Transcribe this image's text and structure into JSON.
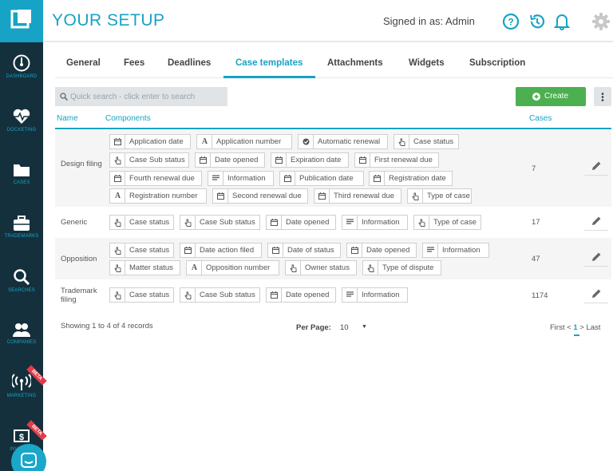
{
  "header": {
    "title": "YOUR SETUP",
    "signed_in": "Signed in as: Admin"
  },
  "sidebar": {
    "items": [
      {
        "label": "DASHBOARD",
        "icon": "gauge-icon"
      },
      {
        "label": "DOCKETING",
        "icon": "heartbeat-icon"
      },
      {
        "label": "CASES",
        "icon": "folder-icon"
      },
      {
        "label": "TRADEMARKS",
        "icon": "briefcase-icon"
      },
      {
        "label": "SEARCHES",
        "icon": "search-icon"
      },
      {
        "label": "COMPANIES",
        "icon": "people-icon"
      },
      {
        "label": "MARKETING",
        "icon": "broadcast-icon",
        "badge": "BETA"
      },
      {
        "label": "INVOICES",
        "icon": "dollar-icon",
        "badge": "BETA"
      }
    ]
  },
  "tabs": [
    "General",
    "Fees",
    "Deadlines",
    "Case templates",
    "Attachments",
    "Widgets",
    "Subscription"
  ],
  "active_tab": "Case templates",
  "search": {
    "placeholder": "Quick search - click enter to search"
  },
  "create_label": "Create",
  "columns": {
    "name": "Name",
    "components": "Components",
    "cases": "Cases"
  },
  "rows": [
    {
      "name": "Design filing",
      "cases": "7",
      "components": [
        {
          "icon": "calendar",
          "label": "Application date"
        },
        {
          "icon": "text",
          "label": "Application number"
        },
        {
          "icon": "check",
          "label": "Automatic renewal"
        },
        {
          "icon": "hand",
          "label": "Case status"
        },
        {
          "icon": "hand",
          "label": "Case Sub status"
        },
        {
          "icon": "calendar",
          "label": "Date opened"
        },
        {
          "icon": "calendar",
          "label": "Expiration date"
        },
        {
          "icon": "calendar",
          "label": "First renewal due"
        },
        {
          "icon": "calendar",
          "label": "Fourth renewal due"
        },
        {
          "icon": "lines",
          "label": "Information"
        },
        {
          "icon": "calendar",
          "label": "Publication date"
        },
        {
          "icon": "calendar",
          "label": "Registration date"
        },
        {
          "icon": "text",
          "label": "Registration number"
        },
        {
          "icon": "calendar",
          "label": "Second renewal due"
        },
        {
          "icon": "calendar",
          "label": "Third renewal due"
        },
        {
          "icon": "hand",
          "label": "Type of case"
        }
      ]
    },
    {
      "name": "Generic",
      "cases": "17",
      "components": [
        {
          "icon": "hand",
          "label": "Case status"
        },
        {
          "icon": "hand",
          "label": "Case Sub status"
        },
        {
          "icon": "calendar",
          "label": "Date opened"
        },
        {
          "icon": "lines",
          "label": "Information"
        },
        {
          "icon": "hand",
          "label": "Type of case"
        }
      ]
    },
    {
      "name": "Opposition",
      "cases": "47",
      "components": [
        {
          "icon": "hand",
          "label": "Case status"
        },
        {
          "icon": "calendar",
          "label": "Date action filed"
        },
        {
          "icon": "calendar",
          "label": "Date of status"
        },
        {
          "icon": "calendar",
          "label": "Date opened"
        },
        {
          "icon": "lines",
          "label": "Information"
        },
        {
          "icon": "hand",
          "label": "Matter status"
        },
        {
          "icon": "text",
          "label": "Opposition number"
        },
        {
          "icon": "hand",
          "label": "Owner status"
        },
        {
          "icon": "hand",
          "label": "Type of dispute"
        }
      ]
    },
    {
      "name": "Trademark filing",
      "cases": "1174",
      "components": [
        {
          "icon": "hand",
          "label": "Case status"
        },
        {
          "icon": "hand",
          "label": "Case Sub status"
        },
        {
          "icon": "calendar",
          "label": "Date opened"
        },
        {
          "icon": "lines",
          "label": "Information"
        }
      ]
    }
  ],
  "footer": {
    "showing": "Showing 1 to 4 of 4 records",
    "per_page_label": "Per Page:",
    "per_page_value": "10",
    "pager_first": "First",
    "pager_prev": "<",
    "pager_current": "1",
    "pager_next": ">",
    "pager_last": "Last"
  },
  "colors": {
    "accent": "#17a3c5",
    "sidebar": "#14303d",
    "create": "#4caf50",
    "beta": "#e23b4a"
  }
}
